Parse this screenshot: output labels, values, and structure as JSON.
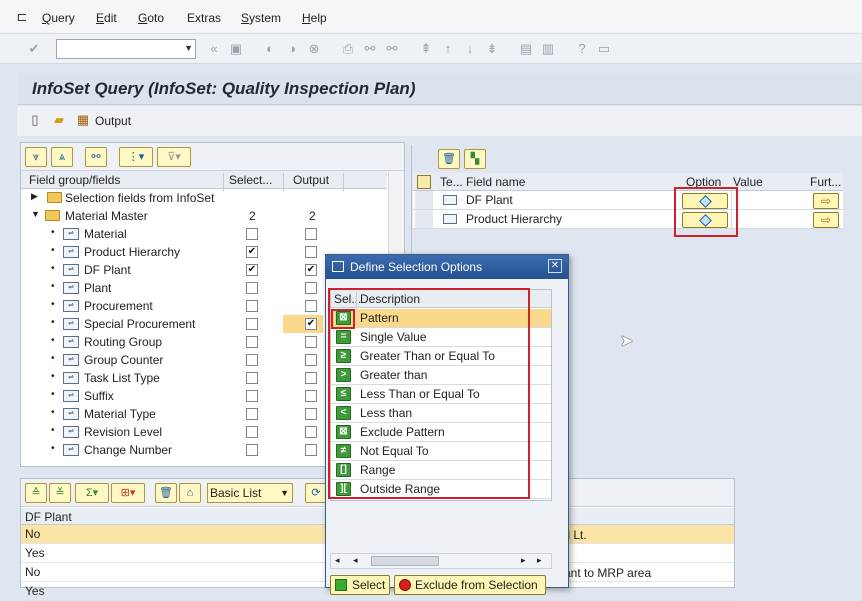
{
  "menu": [
    {
      "label": "Query",
      "u": "Q",
      "rest": "uery"
    },
    {
      "label": "Edit",
      "u": "E",
      "rest": "dit"
    },
    {
      "label": "Goto",
      "u": "G",
      "rest": "oto"
    },
    {
      "label": "Extras",
      "u": "",
      "rest": "Extras"
    },
    {
      "label": "System",
      "u": "S",
      "rest": "ystem"
    },
    {
      "label": "Help",
      "u": "H",
      "rest": "elp"
    }
  ],
  "page_title": "InfoSet Query (InfoSet: Quality Inspection Plan)",
  "app_toolbar": {
    "output_label": "Output"
  },
  "tree": {
    "headers": {
      "field_group": "Field group/fields",
      "selection": "Select...",
      "output": "Output"
    },
    "rows": [
      {
        "label": "Selection fields from InfoSet",
        "type": "folder-top"
      },
      {
        "label": "Material Master",
        "type": "folder-open",
        "sel_count": "2",
        "out_count": "2"
      },
      {
        "label": "Material",
        "type": "field",
        "sel": false,
        "out": false
      },
      {
        "label": "Product Hierarchy",
        "type": "field",
        "sel": true,
        "out": false
      },
      {
        "label": "DF Plant",
        "type": "field",
        "sel": true,
        "out": true
      },
      {
        "label": "Plant",
        "type": "field",
        "sel": false,
        "out": false
      },
      {
        "label": "Procurement",
        "type": "field",
        "sel": false,
        "out": false
      },
      {
        "label": "Special Procurement",
        "type": "field",
        "sel": false,
        "out": true
      },
      {
        "label": "Routing Group",
        "type": "field",
        "sel": false,
        "out": false
      },
      {
        "label": "Group Counter",
        "type": "field",
        "sel": false,
        "out": false
      },
      {
        "label": "Task List Type",
        "type": "field",
        "sel": false,
        "out": false
      },
      {
        "label": "Suffix",
        "type": "field",
        "sel": false,
        "out": false
      },
      {
        "label": "Material Type",
        "type": "field",
        "sel": false,
        "out": false
      },
      {
        "label": "Revision Level",
        "type": "field",
        "sel": false,
        "out": false
      },
      {
        "label": "Change Number",
        "type": "field",
        "sel": false,
        "out": false
      }
    ]
  },
  "selection_grid": {
    "headers": {
      "te": "Te...",
      "field_name": "Field name",
      "option": "Option",
      "value": "Value",
      "further": "Furt..."
    },
    "rows": [
      {
        "field_name": "DF Plant"
      },
      {
        "field_name": "Product Hierarchy"
      }
    ]
  },
  "bottom": {
    "layout_select": "Basic List",
    "column_header": "DF Plant",
    "rows": [
      "No",
      "Yes",
      "No",
      "Yes"
    ],
    "right_snippets": [
      "ti Lt.",
      "ant to MRP area"
    ]
  },
  "dialog": {
    "title": "Define Selection Options",
    "headers": {
      "sel": "Sel...",
      "description": "Description"
    },
    "options": [
      {
        "icon": "⊠",
        "label": "Pattern"
      },
      {
        "icon": "=",
        "label": "Single Value"
      },
      {
        "icon": "≥",
        "label": "Greater Than or Equal To"
      },
      {
        "icon": ">",
        "label": "Greater than"
      },
      {
        "icon": "≤",
        "label": "Less Than or Equal To"
      },
      {
        "icon": "<",
        "label": "Less than"
      },
      {
        "icon": "⊠",
        "label": "Exclude Pattern"
      },
      {
        "icon": "≠",
        "label": "Not Equal To"
      },
      {
        "icon": "[]",
        "label": "Range"
      },
      {
        "icon": "][",
        "label": "Outside Range"
      }
    ],
    "select_label": "Select",
    "exclude_label": "Exclude from Selection"
  }
}
